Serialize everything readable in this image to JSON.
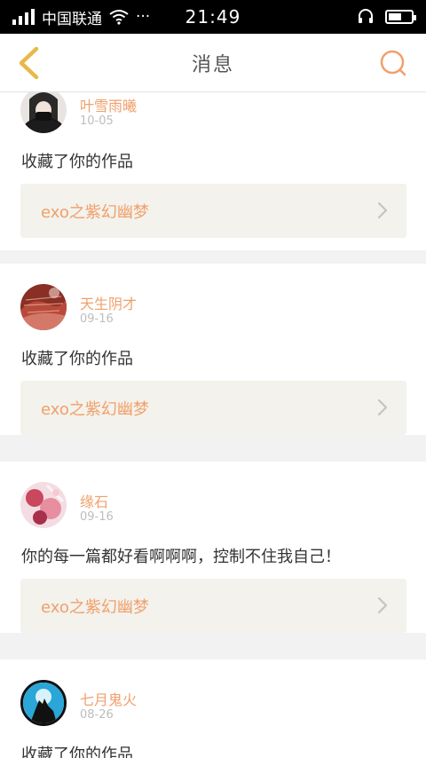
{
  "status_bar": {
    "carrier": "中国联通",
    "time": "21:49",
    "dots": "···",
    "battery_level": 0.6
  },
  "nav": {
    "title": "消息"
  },
  "feed": [
    {
      "user": "叶雪雨曦",
      "date": "10-05",
      "message": "收藏了你的作品",
      "work": "exo之紫幻幽梦"
    },
    {
      "user": "天生阴才",
      "date": "09-16",
      "message": "收藏了你的作品",
      "work": "exo之紫幻幽梦"
    },
    {
      "user": "缘石",
      "date": "09-16",
      "message": "你的每一篇都好看啊啊啊，控制不住我自己！",
      "work": "exo之紫幻幽梦"
    },
    {
      "user": "七月鬼火",
      "date": "08-26",
      "message": "收藏了你的作品",
      "work": ""
    }
  ],
  "colors": {
    "accent": "#f0a06c",
    "back_arrow": "#e8b84a",
    "work_box": "#f3f2ec"
  }
}
